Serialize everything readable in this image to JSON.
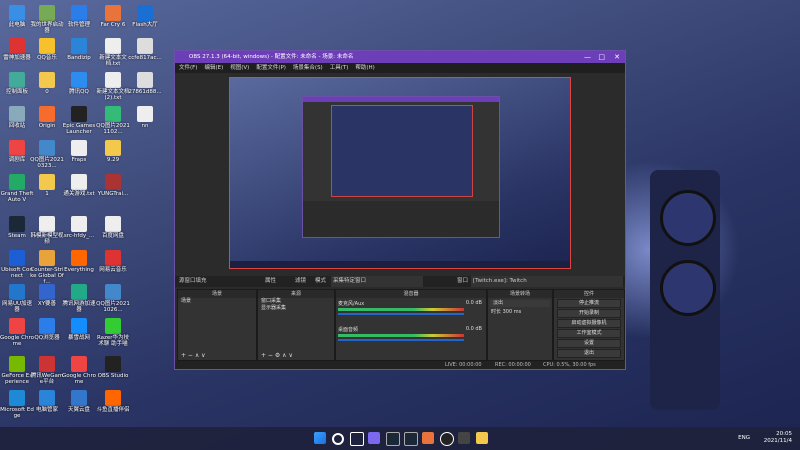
{
  "desktop_icons": [
    {
      "label": "此电脑",
      "color": "#3a8ee6"
    },
    {
      "label": "我的世界启动器",
      "color": "#7a5"
    },
    {
      "label": "软件管理",
      "color": "#2b7de9"
    },
    {
      "label": "Far Cry 6",
      "color": "#e8743b"
    },
    {
      "label": "Flash大厅",
      "color": "#1a6fd4"
    },
    {
      "label": "雷神加速器",
      "color": "#d33"
    },
    {
      "label": "QQ音乐",
      "color": "#f7c12b"
    },
    {
      "label": "Bandizip",
      "color": "#2a85d8"
    },
    {
      "label": "新建文本文档.txt",
      "color": "#eee"
    },
    {
      "label": "ccfe817ac...",
      "color": "#ddd"
    },
    {
      "label": "控制面板",
      "color": "#4a9"
    },
    {
      "label": "0",
      "color": "#f2c94c"
    },
    {
      "label": "腾讯QQ",
      "color": "#2d8cf0"
    },
    {
      "label": "新建文本文档(2).txt",
      "color": "#eee"
    },
    {
      "label": "27861d88...",
      "color": "#ddd"
    },
    {
      "label": "回收站",
      "color": "#8ab"
    },
    {
      "label": "Origin",
      "color": "#f56c2d"
    },
    {
      "label": "Epic Games Launcher",
      "color": "#222"
    },
    {
      "label": "QQ图片20211102...",
      "color": "#3b7"
    },
    {
      "label": "nn",
      "color": "#eee"
    },
    {
      "label": "调剧库",
      "color": "#e44"
    },
    {
      "label": "QQ图片20210323...",
      "color": "#48c"
    },
    {
      "label": "Fraps",
      "color": "#eee"
    },
    {
      "label": "9.29",
      "color": "#f2c94c"
    },
    {
      "label": "Grand Theft Auto V",
      "color": "#2a6"
    },
    {
      "label": "1",
      "color": "#f2c94c"
    },
    {
      "label": "通关游戏.txt",
      "color": "#eee"
    },
    {
      "label": "YUNGTrai...",
      "color": "#a33"
    },
    {
      "label": "Steam",
      "color": "#1b2838"
    },
    {
      "label": "韩模新模型视频",
      "color": "#eee"
    },
    {
      "label": "src-hfdy_...",
      "color": "#eee"
    },
    {
      "label": "百度网盘",
      "color": "#eee"
    },
    {
      "label": "Ubisoft Connect",
      "color": "#1c5fd4"
    },
    {
      "label": "Counter-Strike Global Off...",
      "color": "#e8a33b"
    },
    {
      "label": "Everything",
      "color": "#f60"
    },
    {
      "label": "网易云音乐",
      "color": "#d33"
    },
    {
      "label": "网易UU加速器",
      "color": "#27c"
    },
    {
      "label": "XY要善",
      "color": "#36c"
    },
    {
      "label": "腾讯网游加速器",
      "color": "#2a8"
    },
    {
      "label": "QQ图片20211026...",
      "color": "#48c"
    },
    {
      "label": "Google Chrome",
      "color": "#e44"
    },
    {
      "label": "QQ浏览器",
      "color": "#2b7de9"
    },
    {
      "label": "暴雪战网",
      "color": "#148eff"
    },
    {
      "label": "Razer华为技术聊 助手喵",
      "color": "#3c3"
    },
    {
      "label": "GeForce Experience",
      "color": "#76b900"
    },
    {
      "label": "腾讯WeGame平台",
      "color": "#c33"
    },
    {
      "label": "Google Chrome",
      "color": "#e44"
    },
    {
      "label": "OBS Studio",
      "color": "#222"
    },
    {
      "label": "Microsoft Edge",
      "color": "#1e8ad6"
    },
    {
      "label": "电脑管家",
      "color": "#2a85d8"
    },
    {
      "label": "天翼云盘",
      "color": "#37c"
    },
    {
      "label": "斗鱼直播伴侣",
      "color": "#f60"
    }
  ],
  "obs": {
    "title": "OBS 27.1.3 (64-bit, windows) - 配置文件: 未命名 - 场景: 未命名",
    "menu": [
      "文件(F)",
      "编辑(E)",
      "视图(V)",
      "配置文件(P)",
      "场景集合(S)",
      "工具(T)",
      "帮助(H)"
    ],
    "source_bar": {
      "label": "源窗口填充",
      "props": "属性",
      "filters": "滤镜",
      "mode_label": "模式",
      "mode_value": "采集特定窗口",
      "window_label": "窗口",
      "window_value": "[Twitch.exe]: Twitch"
    },
    "scenes": {
      "header": "场景",
      "items": [
        "场景"
      ]
    },
    "sources": {
      "header": "来源",
      "items": [
        "窗口采集",
        "显示器采集"
      ]
    },
    "mixer": {
      "header": "混音器",
      "tracks": [
        {
          "name": "麦克风/Aux",
          "db": "0.0 dB"
        },
        {
          "name": "桌面音频",
          "db": "0.0 dB"
        }
      ]
    },
    "transitions": {
      "header": "场景转场",
      "type": "淡出",
      "duration_label": "时长",
      "duration": "300 ms"
    },
    "controls": {
      "header": "控件",
      "buttons": [
        "停止推流",
        "开始录制",
        "启动虚拟摄像机",
        "工作室模式",
        "设置",
        "退出"
      ]
    },
    "status": {
      "live": "LIVE: 00:00:00",
      "rec": "REC: 00:00:00",
      "cpu": "CPU: 0.5%, 30.00 fps"
    }
  },
  "taskbar": {
    "lang": "ENG",
    "time": "20:05",
    "date": "2021/11/4"
  }
}
